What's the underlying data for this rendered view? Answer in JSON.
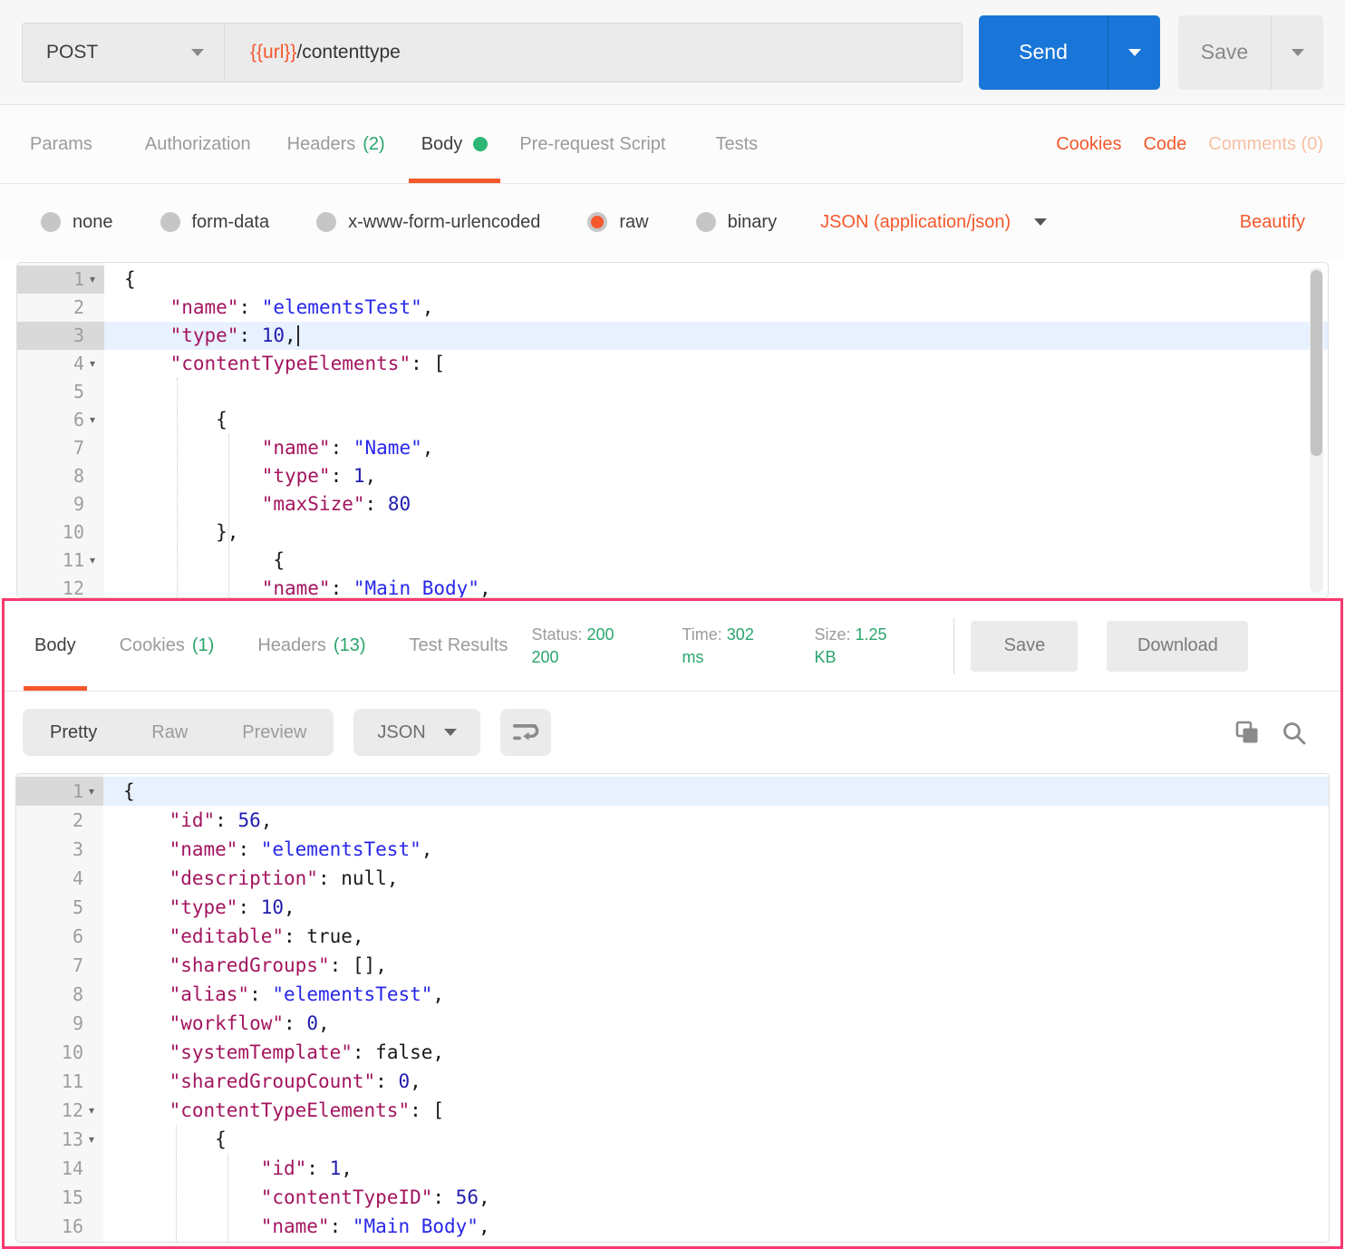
{
  "request_bar": {
    "method": "POST",
    "url_variable": "{{url}}",
    "url_path": "/contenttype",
    "send_label": "Send",
    "save_label": "Save"
  },
  "request_tabs": {
    "items": [
      {
        "label": "Params"
      },
      {
        "label": "Authorization"
      },
      {
        "label": "Headers",
        "count": "(2)"
      },
      {
        "label": "Body",
        "active": true,
        "has_green_dot": true
      },
      {
        "label": "Pre-request Script"
      },
      {
        "label": "Tests"
      }
    ],
    "links": [
      {
        "label": "Cookies"
      },
      {
        "label": "Code"
      },
      {
        "label": "Comments (0)",
        "muted": true
      }
    ]
  },
  "body_type_bar": {
    "options": [
      {
        "label": "none",
        "selected": false
      },
      {
        "label": "form-data",
        "selected": false
      },
      {
        "label": "x-www-form-urlencoded",
        "selected": false
      },
      {
        "label": "raw",
        "selected": true
      },
      {
        "label": "binary",
        "selected": false
      }
    ],
    "content_type": "JSON (application/json)",
    "beautify_label": "Beautify"
  },
  "request_editor": {
    "lines": [
      {
        "n": "1",
        "fold": true,
        "gutter_shade": true,
        "tokens": [
          [
            "pun",
            "{"
          ]
        ]
      },
      {
        "n": "2",
        "tokens": [
          [
            "pun",
            "    "
          ],
          [
            "key",
            "\"name\""
          ],
          [
            "pun",
            ": "
          ],
          [
            "str",
            "\"elementsTest\""
          ],
          [
            "pun",
            ","
          ]
        ]
      },
      {
        "n": "3",
        "active": true,
        "cursor": true,
        "tokens": [
          [
            "pun",
            "    "
          ],
          [
            "key",
            "\"type\""
          ],
          [
            "pun",
            ": "
          ],
          [
            "num",
            "10"
          ],
          [
            "pun",
            ","
          ]
        ]
      },
      {
        "n": "4",
        "fold": true,
        "tokens": [
          [
            "pun",
            "    "
          ],
          [
            "key",
            "\"contentTypeElements\""
          ],
          [
            "pun",
            ": ["
          ]
        ]
      },
      {
        "n": "5",
        "tokens": []
      },
      {
        "n": "6",
        "fold": true,
        "tokens": [
          [
            "pun",
            "        {"
          ]
        ]
      },
      {
        "n": "7",
        "tokens": [
          [
            "pun",
            "            "
          ],
          [
            "key",
            "\"name\""
          ],
          [
            "pun",
            ": "
          ],
          [
            "str",
            "\"Name\""
          ],
          [
            "pun",
            ","
          ]
        ]
      },
      {
        "n": "8",
        "tokens": [
          [
            "pun",
            "            "
          ],
          [
            "key",
            "\"type\""
          ],
          [
            "pun",
            ": "
          ],
          [
            "num",
            "1"
          ],
          [
            "pun",
            ","
          ]
        ]
      },
      {
        "n": "9",
        "tokens": [
          [
            "pun",
            "            "
          ],
          [
            "key",
            "\"maxSize\""
          ],
          [
            "pun",
            ": "
          ],
          [
            "num",
            "80"
          ]
        ]
      },
      {
        "n": "10",
        "tokens": [
          [
            "pun",
            "        },"
          ]
        ]
      },
      {
        "n": "11",
        "fold": true,
        "tokens": [
          [
            "pun",
            "             {"
          ]
        ]
      },
      {
        "n": "12",
        "tokens": [
          [
            "pun",
            "            "
          ],
          [
            "key",
            "\"name\""
          ],
          [
            "pun",
            ": "
          ],
          [
            "str",
            "\"Main Body\""
          ],
          [
            "pun",
            ","
          ]
        ]
      }
    ]
  },
  "response_meta": {
    "tabs": [
      {
        "label": "Body",
        "active": true
      },
      {
        "label": "Cookies",
        "count": "(1)"
      },
      {
        "label": "Headers",
        "count": "(13)"
      },
      {
        "label": "Test Results"
      }
    ],
    "status_label": "Status:",
    "status_value": "200 200",
    "time_label": "Time:",
    "time_value": "302 ms",
    "size_label": "Size:",
    "size_value": "1.25 KB",
    "save_label": "Save",
    "download_label": "Download"
  },
  "response_toolbar": {
    "views": [
      {
        "label": "Pretty",
        "active": true
      },
      {
        "label": "Raw"
      },
      {
        "label": "Preview"
      }
    ],
    "format": "JSON"
  },
  "response_editor": {
    "lines": [
      {
        "n": "1",
        "fold": true,
        "active": true,
        "tokens": [
          [
            "pun",
            "{"
          ]
        ]
      },
      {
        "n": "2",
        "tokens": [
          [
            "pun",
            "    "
          ],
          [
            "key",
            "\"id\""
          ],
          [
            "pun",
            ": "
          ],
          [
            "num",
            "56"
          ],
          [
            "pun",
            ","
          ]
        ]
      },
      {
        "n": "3",
        "tokens": [
          [
            "pun",
            "    "
          ],
          [
            "key",
            "\"name\""
          ],
          [
            "pun",
            ": "
          ],
          [
            "str",
            "\"elementsTest\""
          ],
          [
            "pun",
            ","
          ]
        ]
      },
      {
        "n": "4",
        "tokens": [
          [
            "pun",
            "    "
          ],
          [
            "key",
            "\"description\""
          ],
          [
            "pun",
            ": "
          ],
          [
            "lit",
            "null"
          ],
          [
            "pun",
            ","
          ]
        ]
      },
      {
        "n": "5",
        "tokens": [
          [
            "pun",
            "    "
          ],
          [
            "key",
            "\"type\""
          ],
          [
            "pun",
            ": "
          ],
          [
            "num",
            "10"
          ],
          [
            "pun",
            ","
          ]
        ]
      },
      {
        "n": "6",
        "tokens": [
          [
            "pun",
            "    "
          ],
          [
            "key",
            "\"editable\""
          ],
          [
            "pun",
            ": "
          ],
          [
            "lit",
            "true"
          ],
          [
            "pun",
            ","
          ]
        ]
      },
      {
        "n": "7",
        "tokens": [
          [
            "pun",
            "    "
          ],
          [
            "key",
            "\"sharedGroups\""
          ],
          [
            "pun",
            ": "
          ],
          [
            "lit",
            "[]"
          ],
          [
            "pun",
            ","
          ]
        ]
      },
      {
        "n": "8",
        "tokens": [
          [
            "pun",
            "    "
          ],
          [
            "key",
            "\"alias\""
          ],
          [
            "pun",
            ": "
          ],
          [
            "str",
            "\"elementsTest\""
          ],
          [
            "pun",
            ","
          ]
        ]
      },
      {
        "n": "9",
        "tokens": [
          [
            "pun",
            "    "
          ],
          [
            "key",
            "\"workflow\""
          ],
          [
            "pun",
            ": "
          ],
          [
            "num",
            "0"
          ],
          [
            "pun",
            ","
          ]
        ]
      },
      {
        "n": "10",
        "tokens": [
          [
            "pun",
            "    "
          ],
          [
            "key",
            "\"systemTemplate\""
          ],
          [
            "pun",
            ": "
          ],
          [
            "lit",
            "false"
          ],
          [
            "pun",
            ","
          ]
        ]
      },
      {
        "n": "11",
        "tokens": [
          [
            "pun",
            "    "
          ],
          [
            "key",
            "\"sharedGroupCount\""
          ],
          [
            "pun",
            ": "
          ],
          [
            "num",
            "0"
          ],
          [
            "pun",
            ","
          ]
        ]
      },
      {
        "n": "12",
        "fold": true,
        "tokens": [
          [
            "pun",
            "    "
          ],
          [
            "key",
            "\"contentTypeElements\""
          ],
          [
            "pun",
            ": ["
          ]
        ]
      },
      {
        "n": "13",
        "fold": true,
        "tokens": [
          [
            "pun",
            "        {"
          ]
        ]
      },
      {
        "n": "14",
        "tokens": [
          [
            "pun",
            "            "
          ],
          [
            "key",
            "\"id\""
          ],
          [
            "pun",
            ": "
          ],
          [
            "num",
            "1"
          ],
          [
            "pun",
            ","
          ]
        ]
      },
      {
        "n": "15",
        "tokens": [
          [
            "pun",
            "            "
          ],
          [
            "key",
            "\"contentTypeID\""
          ],
          [
            "pun",
            ": "
          ],
          [
            "num",
            "56"
          ],
          [
            "pun",
            ","
          ]
        ]
      },
      {
        "n": "16",
        "tokens": [
          [
            "pun",
            "            "
          ],
          [
            "key",
            "\"name\""
          ],
          [
            "pun",
            ": "
          ],
          [
            "str",
            "\"Main Body\""
          ],
          [
            "pun",
            ","
          ]
        ]
      }
    ]
  },
  "colors": {
    "accent_orange": "#F4582C",
    "send_blue": "#1976D8",
    "count_green": "#29A56D",
    "body_dot_green": "#2BB673",
    "annotation_pink": "#F9386E",
    "active_line_blue": "#E7F1FF",
    "code_key": "#A3155F",
    "code_string": "#2727E8",
    "code_number": "#211DAD"
  }
}
